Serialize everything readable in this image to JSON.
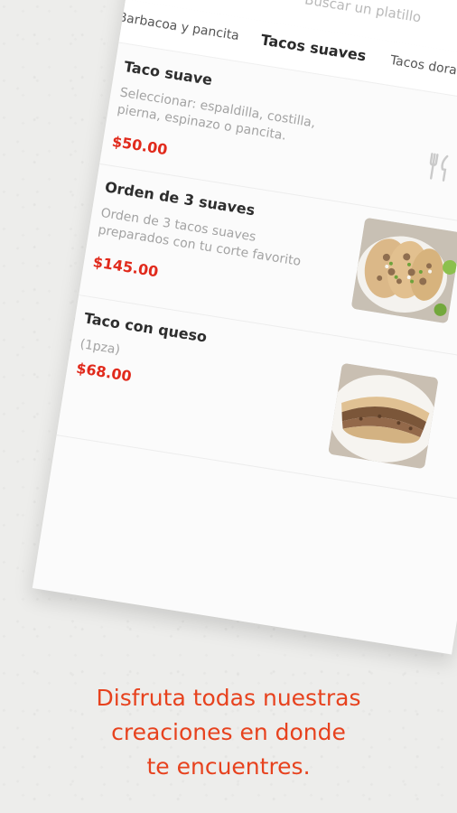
{
  "search": {
    "placeholder": "Buscar un platillo"
  },
  "tabs": [
    {
      "label": "Barbacoa y pancita",
      "active": false
    },
    {
      "label": "Tacos suaves",
      "active": true
    },
    {
      "label": "Tacos dorados",
      "active": false
    }
  ],
  "menu": {
    "items": [
      {
        "name": "Taco suave",
        "description": "Seleccionar: espaldilla, costilla, pierna, espinazo o pancita.",
        "price": "$50.00",
        "image": "utensils-placeholder-icon"
      },
      {
        "name": "Orden de 3 suaves",
        "description": "Orden de 3 tacos suaves preparados con tu corte favorito",
        "price": "$145.00",
        "image": "tacos-plate-photo"
      },
      {
        "name": "Taco con queso",
        "description": "(1pza)",
        "price": "$68.00",
        "image": "taco-queso-photo"
      }
    ]
  },
  "tagline": {
    "line1": "Disfruta todas nuestras",
    "line2": "creaciones en donde",
    "line3": "te encuentres."
  },
  "colors": {
    "price": "#e12a1c",
    "tagline": "#e7421e",
    "background": "#ededeb",
    "card": "#fbfbfb"
  }
}
